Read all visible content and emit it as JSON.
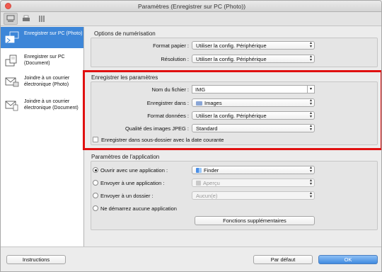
{
  "window": {
    "title": "Paramètres (Enregistrer sur PC (Photo))"
  },
  "toolbar": {
    "tabs": [
      {
        "icon": "scan-to-pc-icon"
      },
      {
        "icon": "printer-icon"
      },
      {
        "icon": "tools-icon"
      }
    ]
  },
  "sidebar": {
    "items": [
      {
        "label": "Enregistrer sur PC (Photo)",
        "icon": "save-photo-icon",
        "active": true
      },
      {
        "label": "Enregistrer sur PC (Document)",
        "icon": "save-document-icon",
        "active": false
      },
      {
        "label": "Joindre à un courrier électronique (Photo)",
        "icon": "email-photo-icon",
        "active": false
      },
      {
        "label": "Joindre à un courrier électronique (Document)",
        "icon": "email-document-icon",
        "active": false
      }
    ]
  },
  "scan_options": {
    "title": "Options de numérisation",
    "paper_size_label": "Format papier :",
    "paper_size_value": "Utiliser la config. Périphérique",
    "resolution_label": "Résolution :",
    "resolution_value": "Utiliser la config. Périphérique"
  },
  "save_settings": {
    "title": "Enregistrer les paramètres",
    "filename_label": "Nom du fichier :",
    "filename_value": "IMG",
    "save_in_label": "Enregistrer dans :",
    "save_in_value": "Images",
    "data_format_label": "Format données :",
    "data_format_value": "Utiliser la config. Périphérique",
    "jpeg_quality_label": "Qualité des images JPEG :",
    "jpeg_quality_value": "Standard",
    "subfolder_label": "Enregistrer dans sous-dossier avec la date courante",
    "subfolder_checked": false,
    "highlight_color": "#e01010"
  },
  "app_settings": {
    "title": "Paramètres de l'application",
    "open_app_label": "Ouvrir avec une application :",
    "open_app_value": "Finder",
    "send_app_label": "Envoyer à une application :",
    "send_app_value": "Aperçu",
    "send_folder_label": "Envoyer à un dossier :",
    "send_folder_value": "Aucun(e)",
    "no_app_label": "Ne démarrez aucune application",
    "selected_option": "open_app",
    "more_functions_label": "Fonctions supplémentaires"
  },
  "footer": {
    "instructions_label": "Instructions",
    "defaults_label": "Par défaut",
    "ok_label": "OK",
    "accent_color": "#3d86d8"
  }
}
